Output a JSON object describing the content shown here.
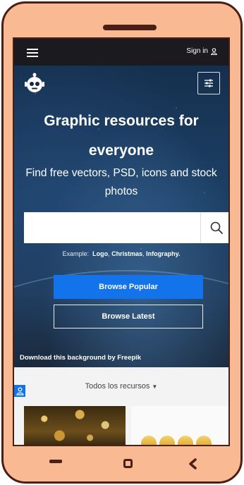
{
  "topbar": {
    "menu_icon": "hamburger-icon",
    "signin_label": "Sign in",
    "signin_icon": "user-icon"
  },
  "hero": {
    "logo_icon": "freepik-robot-logo",
    "filter_icon": "sliders-icon",
    "title": "Graphic resources for everyone",
    "subtitle": "Find free vectors, PSD, icons and stock photos",
    "search": {
      "value": "",
      "placeholder": "",
      "button_icon": "search-icon"
    },
    "examples": {
      "label": "Example:",
      "items": [
        "Logo",
        "Christmas",
        "Infography."
      ]
    },
    "browse_popular": "Browse Popular",
    "browse_latest": "Browse Latest",
    "credit": "Download this background by Freepik"
  },
  "resources": {
    "dropdown_label": "Todos los recursos",
    "dropdown_icon": "caret-down-icon",
    "chat_icon": "user-chat-icon"
  },
  "colors": {
    "accent": "#1273eb",
    "phone_shell": "#f9b993",
    "phone_border": "#4a1f16",
    "topbar": "#1b1b1f"
  }
}
